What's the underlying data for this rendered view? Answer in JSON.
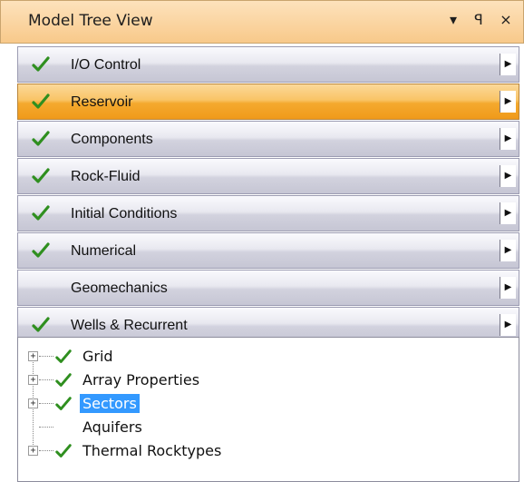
{
  "window": {
    "title": "Model Tree View",
    "buttons": [
      "▾",
      "ꟼ",
      "×"
    ]
  },
  "sections": [
    {
      "label": "I/O Control",
      "checked": true,
      "active": false
    },
    {
      "label": "Reservoir",
      "checked": true,
      "active": true
    },
    {
      "label": "Components",
      "checked": true,
      "active": false
    },
    {
      "label": "Rock-Fluid",
      "checked": true,
      "active": false
    },
    {
      "label": "Initial Conditions",
      "checked": true,
      "active": false
    },
    {
      "label": "Numerical",
      "checked": true,
      "active": false
    },
    {
      "label": "Geomechanics",
      "checked": false,
      "active": false
    },
    {
      "label": "Wells & Recurrent",
      "checked": true,
      "active": false
    }
  ],
  "tree": [
    {
      "label": "Grid",
      "checked": true,
      "expandable": true,
      "selected": false
    },
    {
      "label": "Array Properties",
      "checked": true,
      "expandable": true,
      "selected": false
    },
    {
      "label": "Sectors",
      "checked": true,
      "expandable": true,
      "selected": true
    },
    {
      "label": "Aquifers",
      "checked": false,
      "expandable": false,
      "selected": false
    },
    {
      "label": "Thermal Rocktypes",
      "checked": true,
      "expandable": true,
      "selected": false
    }
  ],
  "colors": {
    "check": "#2f8f1f",
    "active_section": "#f4a92e",
    "selection": "#3399ff"
  },
  "icons": {
    "expand": "plus-icon",
    "section_arrow": "triangle-right-icon",
    "check": "check-icon"
  }
}
